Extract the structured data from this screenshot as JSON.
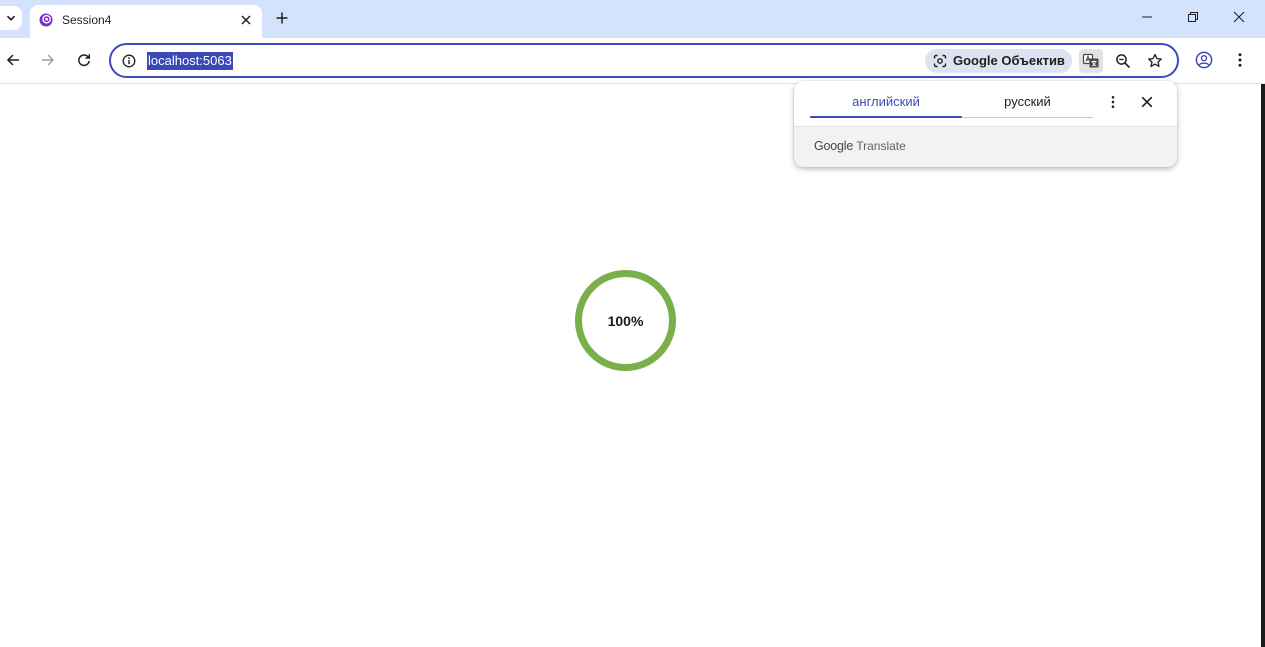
{
  "browser": {
    "tab": {
      "title": "Session4",
      "favicon": "blazor-app-icon"
    },
    "url": "localhost:5063",
    "lens_chip_label": "Google Объектив",
    "colors": {
      "tabstrip_bg": "#d3e3fd",
      "accent": "#3c4bb5"
    }
  },
  "translate_bubble": {
    "tabs": [
      {
        "label": "английский",
        "selected": true
      },
      {
        "label": "русский",
        "selected": false
      }
    ],
    "footer_brand_google": "Google",
    "footer_brand_translate": "Translate"
  },
  "page": {
    "progress": {
      "percent": 100,
      "label": "100%",
      "color": "#7ab04c"
    }
  }
}
